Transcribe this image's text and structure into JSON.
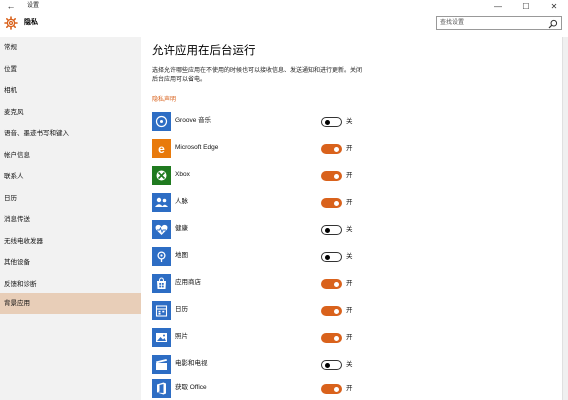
{
  "window": {
    "back_glyph": "←",
    "title": "设置",
    "minimize_glyph": "—",
    "maximize_glyph": "☐",
    "close_glyph": "✕"
  },
  "header": {
    "title": "隐私",
    "icon": "gear-icon",
    "search_placeholder": "查找设置",
    "search_icon": "search-icon"
  },
  "sidebar": {
    "items": [
      {
        "label": "常规"
      },
      {
        "label": "位置"
      },
      {
        "label": "相机"
      },
      {
        "label": "麦克风"
      },
      {
        "label": "语音、墨迹书写和键入"
      },
      {
        "label": "帐户信息"
      },
      {
        "label": "联系人"
      },
      {
        "label": "日历"
      },
      {
        "label": "消息传送"
      },
      {
        "label": "无线电收发器"
      },
      {
        "label": "其他设备"
      },
      {
        "label": "反馈和诊断"
      },
      {
        "label": "背景应用"
      }
    ],
    "selected_index": 12
  },
  "content": {
    "title": "允许应用在后台运行",
    "description": "选择允许哪些应用在不使用的时候也可以接收信息、发送通知和进行更新。关闭后台应用可以省电。",
    "privacy_link": "隐私声明",
    "apps": [
      {
        "name": "Groove 音乐",
        "state": "关",
        "on": false,
        "icon": "groove-music-icon",
        "color": "#2d6dc4"
      },
      {
        "name": "Microsoft Edge",
        "state": "开",
        "on": true,
        "icon": "edge-icon",
        "color": "#e87a0c"
      },
      {
        "name": "Xbox",
        "state": "开",
        "on": true,
        "icon": "xbox-icon",
        "color": "#1f7a1f"
      },
      {
        "name": "人脉",
        "state": "开",
        "on": true,
        "icon": "people-icon",
        "color": "#2d6dc4"
      },
      {
        "name": "健康",
        "state": "关",
        "on": false,
        "icon": "health-icon",
        "color": "#2d6dc4"
      },
      {
        "name": "地图",
        "state": "关",
        "on": false,
        "icon": "maps-icon",
        "color": "#2d6dc4"
      },
      {
        "name": "应用商店",
        "state": "开",
        "on": true,
        "icon": "store-icon",
        "color": "#2d6dc4"
      },
      {
        "name": "日历",
        "state": "开",
        "on": true,
        "icon": "calendar-icon",
        "color": "#2d6dc4"
      },
      {
        "name": "照片",
        "state": "开",
        "on": true,
        "icon": "photos-icon",
        "color": "#2d6dc4"
      },
      {
        "name": "电影和电视",
        "state": "关",
        "on": false,
        "icon": "movies-tv-icon",
        "color": "#2d6dc4"
      },
      {
        "name": "获取 Office",
        "state": "开",
        "on": true,
        "icon": "office-icon",
        "color": "#2d6dc4"
      }
    ]
  },
  "colors": {
    "accent": "#d9621c",
    "sidebar_bg": "#f2f2f2",
    "sidebar_selected": "#e8ceb8"
  }
}
